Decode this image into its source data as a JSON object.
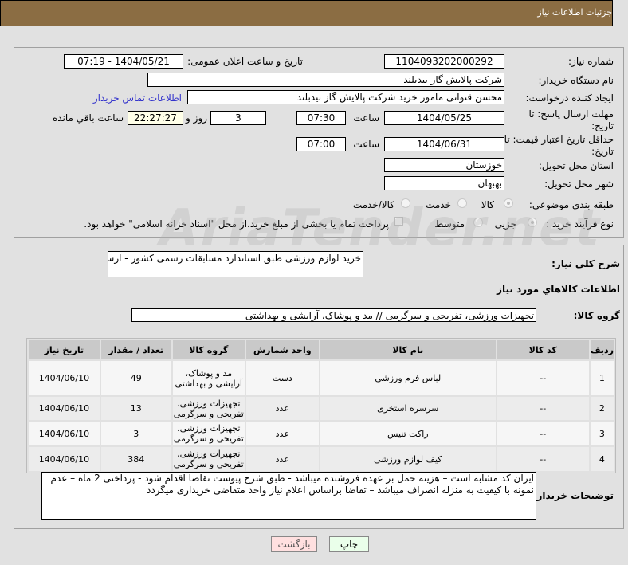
{
  "header": {
    "title": "جزئیات اطلاعات نیاز"
  },
  "watermark": "AriaTender.net",
  "form": {
    "need_number_label": "شماره نیاز:",
    "need_number": "1104093202000292",
    "announce_label": "تاریخ و ساعت اعلان عمومی:",
    "announce_value": "1404/05/21 - 07:19",
    "buyer_org_label": "نام دستگاه خریدار:",
    "buyer_org": "شرکت پالایش گاز بیدبلند",
    "creator_label": "ایجاد کننده درخواست:",
    "creator": "محسن قنواتی مامور خرید شرکت پالایش گاز بیدبلند",
    "contact_link": "اطلاعات تماس خریدار",
    "deadline_label": "مهلت ارسال پاسخ: تا تاریخ:",
    "deadline_date": "1404/05/25",
    "time_label": "ساعت",
    "deadline_time": "07:30",
    "days": "3",
    "days_label": "روز و",
    "remaining": "22:27:27",
    "remaining_label": "ساعت باقي مانده",
    "validity_label": "حداقل تاریخ اعتبار قیمت: تا تاریخ:",
    "validity_date": "1404/06/31",
    "validity_time": "07:00",
    "province_label": "استان محل تحویل:",
    "province": "خوزستان",
    "city_label": "شهر محل تحویل:",
    "city": "بهبهان",
    "category_label": "طبقه بندی موضوعی:",
    "category_options": [
      "کالا",
      "خدمت",
      "کالا/خدمت"
    ],
    "category_selected": "کالا",
    "process_label": "نوع فرآیند خرید :",
    "process_options": [
      "جزیی",
      "متوسط"
    ],
    "process_selected": "جزیی",
    "payment_note": "پرداخت تمام یا بخشی از مبلغ خرید،از محل \"اسناد خزانه اسلامی\" خواهد بود."
  },
  "details": {
    "description_label": "شرح كلي نياز:",
    "description": "خرید لوازم ورزشی طبق استاندارد مسابقات رسمی کشور - ارسال نمونه باکیفیت الزامیست",
    "goods_info_title": "اطلاعات كالاهاي مورد نياز",
    "goods_group_label": "گروه کالا:",
    "goods_group": "تجهیزات ورزشی، تفریحی و سرگرمی // مد و پوشاک، آرایشی و بهداشتی",
    "table": {
      "headers": [
        "ردیف",
        "کد کالا",
        "نام کالا",
        "واحد شمارش",
        "گروه کالا",
        "تعداد / مقدار",
        "تاریخ نیاز"
      ],
      "rows": [
        [
          "1",
          "--",
          "لباس فرم ورزشی",
          "دست",
          "مد و پوشاک، آرایشی و بهداشتی",
          "49",
          "1404/06/10"
        ],
        [
          "2",
          "--",
          "سرسره استخری",
          "عدد",
          "تجهیزات ورزشی، تفریحی و سرگرمی",
          "13",
          "1404/06/10"
        ],
        [
          "3",
          "--",
          "راکت تنیس",
          "عدد",
          "تجهیزات ورزشی، تفریحی و سرگرمی",
          "3",
          "1404/06/10"
        ],
        [
          "4",
          "--",
          "کیف لوازم ورزشی",
          "عدد",
          "تجهیزات ورزشی، تفریحی و سرگرمی",
          "384",
          "1404/06/10"
        ]
      ]
    },
    "buyer_notes_label": "توضیحات خریدار:",
    "buyer_notes": "ایران کد مشابه است  – هزینه حمل بر عهده فروشنده میباشد -  طبق شرح پیوست تقاضا اقدام شود - پرداختی 2 ماه – عدم نمونه با کیفیت  به منزله انصراف میباشد  – تقاضا براساس اعلام نیاز واحد متقاضی خریداری میگردد"
  },
  "buttons": {
    "print": "چاپ",
    "back": "بازگشت"
  },
  "colors": {
    "header": "#8b6d43",
    "link": "#3333cc",
    "print_bg": "#eaffea",
    "back_bg": "#ffe0e0"
  }
}
